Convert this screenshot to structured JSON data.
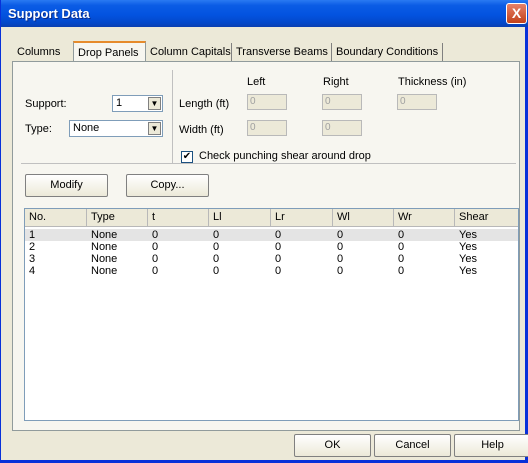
{
  "window": {
    "title": "Support Data",
    "close_label": "X"
  },
  "tabs": [
    "Columns",
    "Drop Panels",
    "Column Capitals",
    "Transverse Beams",
    "Boundary Conditions"
  ],
  "form": {
    "support_label": "Support:",
    "support_value": "1",
    "type_label": "Type:",
    "type_value": "None",
    "col_left": "Left",
    "col_right": "Right",
    "col_thickness": "Thickness (in)",
    "length_label": "Length (ft)",
    "width_label": "Width (ft)",
    "length_left": "0",
    "length_right": "0",
    "thickness": "0",
    "width_left": "0",
    "width_right": "0",
    "check_label": "Check punching shear around drop",
    "check_mark": "✔"
  },
  "actions": {
    "modify": "Modify",
    "copy": "Copy..."
  },
  "table": {
    "headers": [
      "No.",
      "Type",
      "t",
      "Ll",
      "Lr",
      "Wl",
      "Wr",
      "Shear"
    ],
    "rows": [
      [
        "1",
        "None",
        "0",
        "0",
        "0",
        "0",
        "0",
        "Yes"
      ],
      [
        "2",
        "None",
        "0",
        "0",
        "0",
        "0",
        "0",
        "Yes"
      ],
      [
        "3",
        "None",
        "0",
        "0",
        "0",
        "0",
        "0",
        "Yes"
      ],
      [
        "4",
        "None",
        "0",
        "0",
        "0",
        "0",
        "0",
        "Yes"
      ]
    ]
  },
  "footer": {
    "ok": "OK",
    "cancel": "Cancel",
    "help": "Help"
  }
}
